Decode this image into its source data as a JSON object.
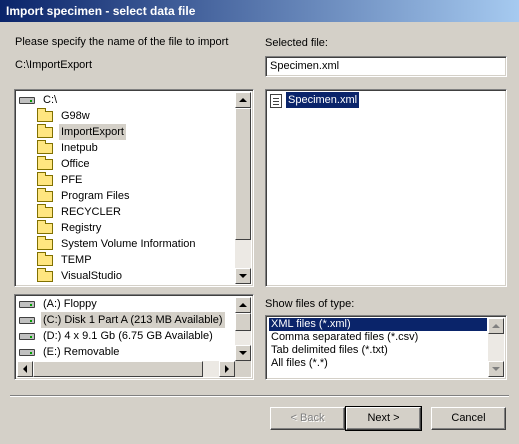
{
  "window": {
    "title": "Import specimen - select data file"
  },
  "left": {
    "prompt": "Please specify the name of the file to import",
    "current_path": "C:\\ImportExport",
    "folder_tree": {
      "root": "C:\\",
      "items": [
        {
          "label": "G98w",
          "selected": false
        },
        {
          "label": "ImportExport",
          "selected": true
        },
        {
          "label": "Inetpub",
          "selected": false
        },
        {
          "label": "Office",
          "selected": false
        },
        {
          "label": "PFE",
          "selected": false
        },
        {
          "label": "Program Files",
          "selected": false
        },
        {
          "label": "RECYCLER",
          "selected": false
        },
        {
          "label": "Registry",
          "selected": false
        },
        {
          "label": "System Volume Information",
          "selected": false
        },
        {
          "label": "TEMP",
          "selected": false
        },
        {
          "label": "VisualStudio",
          "selected": false
        }
      ]
    },
    "drives": [
      {
        "label": "(A:)  Floppy",
        "selected": false
      },
      {
        "label": "(C:)  Disk 1 Part A  (213 MB Available)",
        "selected": true
      },
      {
        "label": "(D:)  4 x 9.1 Gb  (6.75 GB Available)",
        "selected": false
      },
      {
        "label": "(E:)  Removable",
        "selected": false
      }
    ]
  },
  "right": {
    "selected_file_label": "Selected file:",
    "selected_file_value": "Specimen.xml",
    "files": [
      {
        "label": "Specimen.xml",
        "selected": true
      }
    ],
    "file_type_label": "Show files of type:",
    "file_types": [
      {
        "label": "XML files (*.xml)",
        "selected": true
      },
      {
        "label": "Comma separated files (*.csv)",
        "selected": false
      },
      {
        "label": "Tab delimited files (*.txt)",
        "selected": false
      },
      {
        "label": "All files (*.*)",
        "selected": false
      }
    ]
  },
  "buttons": {
    "back_label": "< Back",
    "next_label": "Next >",
    "cancel_label": "Cancel"
  }
}
